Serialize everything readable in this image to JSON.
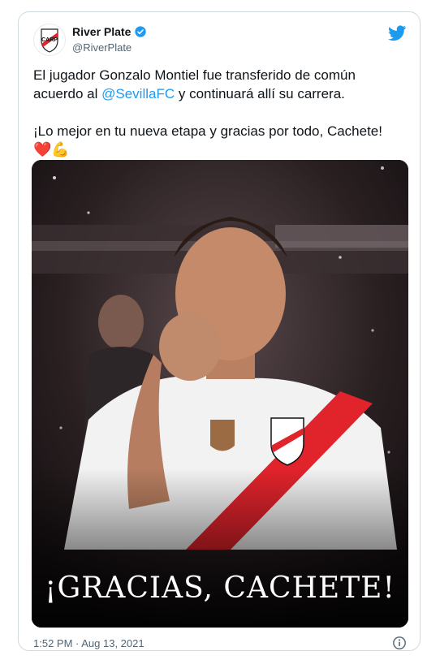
{
  "tweet": {
    "author": {
      "display_name": "River Plate",
      "handle": "@RiverPlate",
      "verified": true,
      "avatar_icon": "river-plate-crest-icon"
    },
    "brand_icon": "twitter-bird-icon",
    "text": {
      "line1_prefix": "El jugador Gonzalo Montiel fue transferido de común acuerdo al ",
      "mention": "@SevillaFC",
      "line1_suffix": " y continuará allí su carrera.",
      "line2": "¡Lo mejor en tu nueva etapa y gracias por todo, Cachete!",
      "emojis": "❤️💪"
    },
    "media": {
      "banner": "¡GRACIAS, CACHETE!"
    },
    "timestamp": "1:52 PM · Aug 13, 2021",
    "info_icon": "info-icon"
  },
  "colors": {
    "accent": "#1d9bf0",
    "river_red": "#e1232b",
    "text_secondary": "#536471"
  }
}
